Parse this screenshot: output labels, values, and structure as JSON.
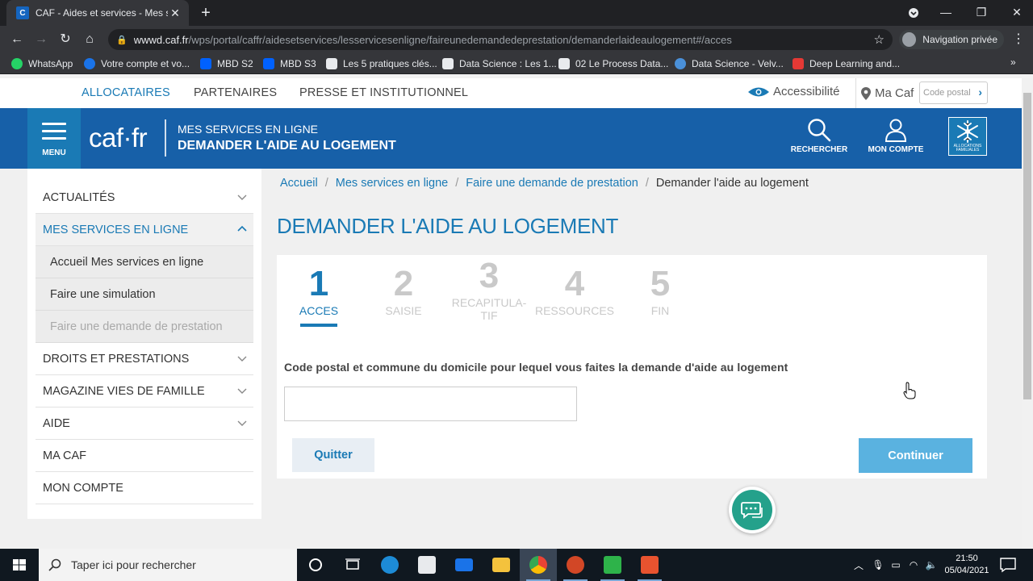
{
  "browser": {
    "tab_title": "CAF - Aides et services - Mes ser",
    "url_host": "wwwd.caf.fr",
    "url_path": "/wps/portal/caffr/aidesetservices/lesservicesenligne/faireunedemandedeprestation/demanderlaideaulogement#/acces",
    "profile_label": "Navigation privée",
    "bookmarks": [
      {
        "label": "WhatsApp",
        "color": "#25d366"
      },
      {
        "label": "Votre compte et vo...",
        "color": "#1a73e8"
      },
      {
        "label": "MBD S2",
        "color": "#0061ff"
      },
      {
        "label": "MBD S3",
        "color": "#0061ff"
      },
      {
        "label": "Les 5 pratiques clés...",
        "color": "#e8eaed"
      },
      {
        "label": "Data Science : Les 1...",
        "color": "#e8eaed"
      },
      {
        "label": "02 Le Process Data...",
        "color": "#e8eaed"
      },
      {
        "label": "Data Science - Velv...",
        "color": "#4a90d9"
      },
      {
        "label": "Deep Learning and...",
        "color": "#e53935"
      }
    ],
    "bookmarks_more": "»"
  },
  "site": {
    "topnav": {
      "allocataires": "ALLOCATAIRES",
      "partenaires": "PARTENAIRES",
      "presse": "PRESSE ET INSTITUTIONNEL",
      "accessibilite": "Accessibilité",
      "ma_caf": "Ma Caf",
      "code_postal_placeholder": "Code postal"
    },
    "banner": {
      "menu_label": "MENU",
      "logo": "caf·fr",
      "subtitle": "MES SERVICES EN LIGNE",
      "title": "DEMANDER L'AIDE AU LOGEMENT",
      "search_label": "RECHERCHER",
      "account_label": "MON COMPTE",
      "emblem_text": "ALLOCATIONS FAMILIALES"
    },
    "sidebar": {
      "items": [
        {
          "label": "ACTUALITÉS"
        },
        {
          "label": "MES SERVICES EN LIGNE"
        },
        {
          "label": "DROITS ET PRESTATIONS"
        },
        {
          "label": "MAGAZINE VIES DE FAMILLE"
        },
        {
          "label": "AIDE"
        },
        {
          "label": "MA CAF"
        },
        {
          "label": "MON COMPTE"
        }
      ],
      "sub_items": [
        {
          "label": "Accueil Mes services en ligne"
        },
        {
          "label": "Faire une simulation"
        },
        {
          "label": "Faire une demande de prestation"
        }
      ]
    },
    "breadcrumb": {
      "items": [
        "Accueil",
        "Mes services en ligne",
        "Faire une demande de prestation"
      ],
      "current": "Demander l'aide au logement"
    },
    "page_title": "DEMANDER L'AIDE AU LOGEMENT",
    "steps": [
      {
        "num": "1",
        "label": "ACCES"
      },
      {
        "num": "2",
        "label": "SAISIE"
      },
      {
        "num": "3",
        "label_line1": "RECAPITULA-",
        "label_line2": "TIF"
      },
      {
        "num": "4",
        "label": "RESSOURCES"
      },
      {
        "num": "5",
        "label": "FIN"
      }
    ],
    "form": {
      "label": "Code postal et commune du domicile pour lequel vous faites la demande d'aide au logement",
      "input_value": "",
      "quit_label": "Quitter",
      "continue_label": "Continuer"
    }
  },
  "taskbar": {
    "search_placeholder": "Taper ici pour rechercher",
    "time": "21:50",
    "date": "05/04/2021"
  },
  "colors": {
    "brand_blue": "#1760a8",
    "link_blue": "#1a7ab5",
    "continue_button": "#5ab2e0",
    "chat_green": "#24a18b"
  }
}
